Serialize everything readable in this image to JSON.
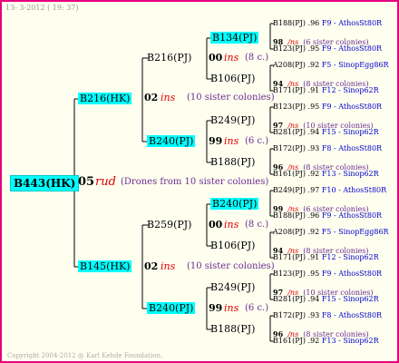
{
  "header": {
    "date": "13- 3-2012 ( 19: 37)"
  },
  "footer": {
    "copyright": "Copyright 2004-2012 @ Karl Kehde Foundation."
  },
  "root": {
    "id": "B443(HK)",
    "num": "05",
    "species": "rud",
    "note": "(Drones from 10 sister colonies)",
    "parents": [
      {
        "id": "B216(HK)",
        "num": "02",
        "species": "ins",
        "note": "(10 sister colonies)",
        "children": [
          {
            "id": "B216(PJ)",
            "num": "00",
            "species": "ins",
            "note": "(8 c.)",
            "children": [
              {
                "id": "B134(PJ)",
                "hl": true,
                "num": "98",
                "species": "/ns",
                "note": "(6 sister colonies)",
                "lines": [
                  {
                    "id": "B188(PJ)",
                    "v": ".96",
                    "rel": "F9 - AthosSt80R"
                  },
                  {
                    "id": "B123(PJ)",
                    "v": ".95",
                    "rel": "F9 - AthosSt80R"
                  }
                ]
              },
              {
                "id": "B106(PJ)",
                "hl": false,
                "num": "94",
                "species": "/ns",
                "note": "(8 sister colonies)",
                "lines": [
                  {
                    "id": "A208(PJ)",
                    "v": ".92",
                    "rel": "F5 - SinopEgg86R"
                  },
                  {
                    "id": "B171(PJ)",
                    "v": ".91",
                    "rel": "F12 - Sinop62R"
                  }
                ]
              }
            ]
          },
          {
            "id": "B240(PJ)",
            "hl": true,
            "num": "99",
            "species": "ins",
            "note": "(6 c.)",
            "children": [
              {
                "id": "B249(PJ)",
                "hl": false,
                "num": "97",
                "species": "/ns",
                "note": "(10 sister colonies)",
                "lines": [
                  {
                    "id": "B123(PJ)",
                    "v": ".95",
                    "rel": "F9 - AthosSt80R"
                  },
                  {
                    "id": "B281(PJ)",
                    "v": ".94",
                    "rel": "F15 - Sinop62R"
                  }
                ]
              },
              {
                "id": "B188(PJ)",
                "hl": false,
                "num": "96",
                "species": "/ns",
                "note": "(8 sister colonies)",
                "lines": [
                  {
                    "id": "B172(PJ)",
                    "v": ".93",
                    "rel": "F8 - AthosSt80R"
                  },
                  {
                    "id": "B161(PJ)",
                    "v": ".92",
                    "rel": "F13 - Sinop62R"
                  }
                ]
              }
            ]
          }
        ]
      },
      {
        "id": "B145(HK)",
        "num": "02",
        "species": "ins",
        "note": "(10 sister colonies)",
        "children": [
          {
            "id": "B259(PJ)",
            "num": "00",
            "species": "ins",
            "note": "(8 c.)",
            "children": [
              {
                "id": "B240(PJ)",
                "hl": true,
                "num": "99",
                "species": "/ns",
                "note": "(6 sister colonies)",
                "lines": [
                  {
                    "id": "B249(PJ)",
                    "v": ".97",
                    "rel": "F10 - AthosSt80R"
                  },
                  {
                    "id": "B188(PJ)",
                    "v": ".96",
                    "rel": "F9 - AthosSt80R"
                  }
                ]
              },
              {
                "id": "B106(PJ)",
                "hl": false,
                "num": "94",
                "species": "/ns",
                "note": "(8 sister colonies)",
                "lines": [
                  {
                    "id": "A208(PJ)",
                    "v": ".92",
                    "rel": "F5 - SinopEgg86R"
                  },
                  {
                    "id": "B171(PJ)",
                    "v": ".91",
                    "rel": "F12 - Sinop62R"
                  }
                ]
              }
            ]
          },
          {
            "id": "B240(PJ)",
            "hl": true,
            "num": "99",
            "species": "ins",
            "note": "(6 c.)",
            "children": [
              {
                "id": "B249(PJ)",
                "hl": false,
                "num": "97",
                "species": "/ns",
                "note": "(10 sister colonies)",
                "lines": [
                  {
                    "id": "B123(PJ)",
                    "v": ".95",
                    "rel": "F9 - AthosSt80R"
                  },
                  {
                    "id": "B281(PJ)",
                    "v": ".94",
                    "rel": "F15 - Sinop62R"
                  }
                ]
              },
              {
                "id": "B188(PJ)",
                "hl": false,
                "num": "96",
                "species": "/ns",
                "note": "(8 sister colonies)",
                "lines": [
                  {
                    "id": "B172(PJ)",
                    "v": ".93",
                    "rel": "F8 - AthosSt80R"
                  },
                  {
                    "id": "B161(PJ)",
                    "v": ".92",
                    "rel": "F13 - Sinop62R"
                  }
                ]
              }
            ]
          }
        ]
      }
    ]
  }
}
